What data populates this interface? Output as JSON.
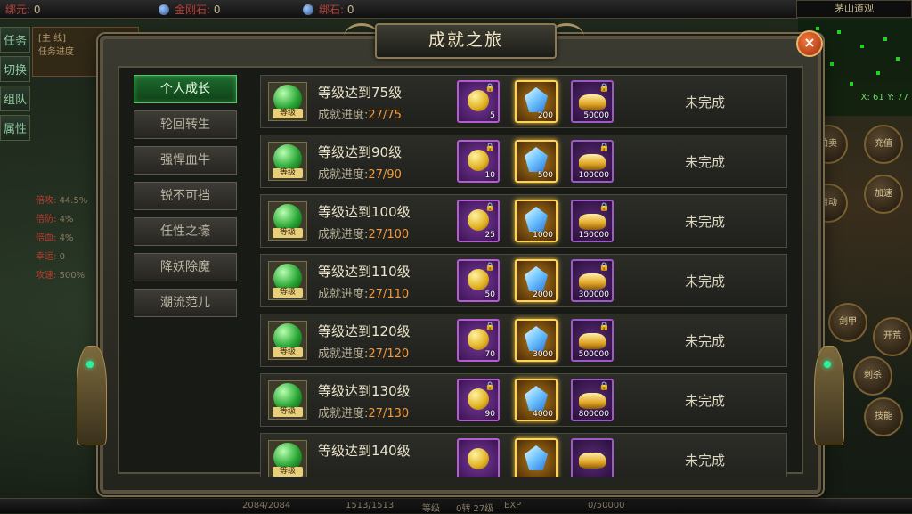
{
  "hud": {
    "top_resources": [
      {
        "label": "绑元:",
        "value": "0"
      },
      {
        "label": "金刚石:",
        "value": "0"
      },
      {
        "label": "绑石:",
        "value": "0"
      }
    ],
    "map_name": "茅山道观",
    "coords": "X: 61  Y: 77",
    "left_tabs": [
      "任务",
      "切换",
      "组队",
      "属性"
    ],
    "task_box": {
      "line1": "[主 线]",
      "line2": "任务进度"
    },
    "stats": [
      {
        "label": "倍攻:",
        "value": "44.5%"
      },
      {
        "label": "倍防:",
        "value": "4%"
      },
      {
        "label": "倍血:",
        "value": "4%"
      },
      {
        "label": "幸运:",
        "value": "0"
      },
      {
        "label": "攻速:",
        "value": "500%"
      }
    ],
    "skills": [
      "拍卖",
      "充值",
      "自动",
      "加速",
      "剑甲",
      "开荒",
      "刺杀",
      "技能"
    ],
    "bottom": {
      "hp": "2084/2084",
      "mp": "1513/1513",
      "level_label": "等级",
      "level": "0转 27级",
      "exp_label": "EXP",
      "exp": "0/50000"
    }
  },
  "dialog": {
    "title": "成就之旅",
    "close_label": "×",
    "menu": [
      {
        "label": "个人成长",
        "active": true
      },
      {
        "label": "轮回转生",
        "active": false
      },
      {
        "label": "强悍血牛",
        "active": false
      },
      {
        "label": "锐不可挡",
        "active": false
      },
      {
        "label": "任性之壕",
        "active": false
      },
      {
        "label": "降妖除魔",
        "active": false
      },
      {
        "label": "潮流范儿",
        "active": false
      }
    ],
    "badge_label": "等级",
    "progress_label": "成就进度:",
    "rows": [
      {
        "title": "等级达到75级",
        "progress": "27/75",
        "rewards": [
          "5",
          "200",
          "50000"
        ],
        "status": "未完成"
      },
      {
        "title": "等级达到90级",
        "progress": "27/90",
        "rewards": [
          "10",
          "500",
          "100000"
        ],
        "status": "未完成"
      },
      {
        "title": "等级达到100级",
        "progress": "27/100",
        "rewards": [
          "25",
          "1000",
          "150000"
        ],
        "status": "未完成"
      },
      {
        "title": "等级达到110级",
        "progress": "27/110",
        "rewards": [
          "50",
          "2000",
          "300000"
        ],
        "status": "未完成"
      },
      {
        "title": "等级达到120级",
        "progress": "27/120",
        "rewards": [
          "70",
          "3000",
          "500000"
        ],
        "status": "未完成"
      },
      {
        "title": "等级达到130级",
        "progress": "27/130",
        "rewards": [
          "90",
          "4000",
          "800000"
        ],
        "status": "未完成"
      },
      {
        "title": "等级达到140级",
        "progress": "27/140",
        "rewards": [
          "",
          "",
          ""
        ],
        "status": "未完成"
      }
    ]
  }
}
